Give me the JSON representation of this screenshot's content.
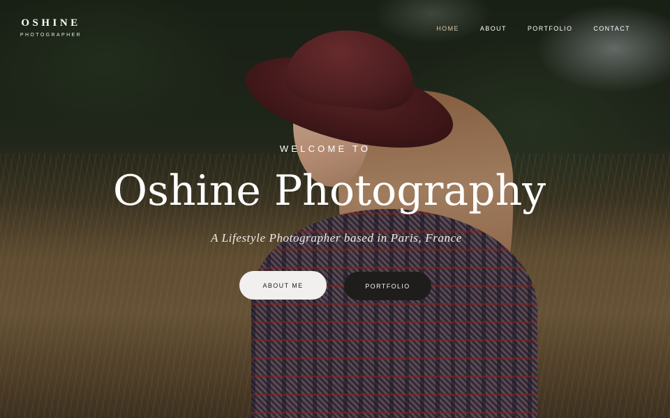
{
  "brand": {
    "title": "OSHINE",
    "subtitle": "PHOTOGRAPHER"
  },
  "nav": {
    "items": [
      {
        "label": "HOME",
        "active": true
      },
      {
        "label": "ABOUT",
        "active": false
      },
      {
        "label": "PORTFOLIO",
        "active": false
      },
      {
        "label": "CONTACT",
        "active": false
      }
    ]
  },
  "hero": {
    "kicker": "WELCOME TO",
    "title": "Oshine Photography",
    "subtitle": "A Lifestyle Photographer based in Paris, France",
    "buttons": {
      "about": "ABOUT ME",
      "portfolio": "PORTFOLIO"
    }
  },
  "colors": {
    "nav_active": "#d9c9a9",
    "button_light": "#f2f0ee",
    "button_dark": "#1e1d1b"
  }
}
